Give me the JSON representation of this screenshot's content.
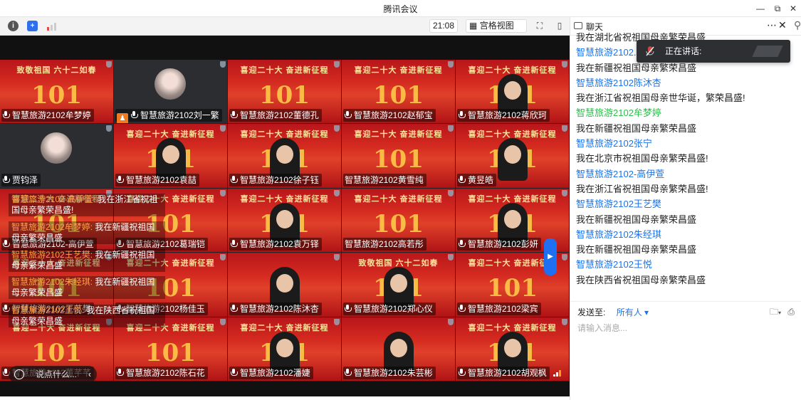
{
  "window": {
    "title": "腾讯会议"
  },
  "toolbar": {
    "time": "21:08",
    "view_label": "宫格视图",
    "colors": {
      "info": "#555555",
      "shield": "#2f6fec",
      "signal": "#e24b4b"
    }
  },
  "tiles": [
    {
      "name": "智慧旅游2102牟梦婷",
      "banner": "致敬祖国 六十二如春",
      "big": "101",
      "style": "red",
      "mic": "on"
    },
    {
      "name": "智慧旅游2102刘一繁",
      "banner": "",
      "big": "",
      "style": "dark-avatar",
      "mic": "speaking"
    },
    {
      "name": "智慧旅游2102董德孔",
      "banner": "喜迎二十大 奋进新征程",
      "big": "101",
      "style": "red",
      "mic": "off"
    },
    {
      "name": "智慧旅游2102赵郁宝",
      "banner": "喜迎二十大 奋进新征程",
      "big": "101",
      "style": "red",
      "mic": "off"
    },
    {
      "name": "智慧旅游2102蒋欣珂",
      "banner": "喜迎二十大 奋进新征程",
      "big": "101",
      "style": "red-person",
      "mic": "off"
    },
    {
      "name": "贾钧泽",
      "banner": "",
      "big": "",
      "style": "dark-avatar",
      "mic": "off"
    },
    {
      "name": "智慧旅游2102袁喆",
      "banner": "喜迎二十大 奋进新征程",
      "big": "101",
      "style": "red-person",
      "mic": "off"
    },
    {
      "name": "智慧旅游2102徐子钰",
      "banner": "喜迎二十大 奋进新征程",
      "big": "101",
      "style": "red-person",
      "mic": "off"
    },
    {
      "name": "智慧旅游2102黄雪纯",
      "banner": "喜迎二十大 奋进新征程",
      "big": "101",
      "style": "red",
      "mic": "none"
    },
    {
      "name": "黄昱皓",
      "banner": "喜迎二十大 奋进新征程",
      "big": "101",
      "style": "red-person",
      "mic": "off"
    },
    {
      "name": "智慧旅游2102-高伊萱",
      "banner": "喜迎二十大 奋进新征程",
      "big": "101",
      "style": "red",
      "mic": "off"
    },
    {
      "name": "智慧旅游2102葛瑞铠",
      "banner": "喜迎二十大 奋进新征程",
      "big": "101",
      "style": "red",
      "mic": "off"
    },
    {
      "name": "智慧旅游2102袁万铎",
      "banner": "喜迎二十大 奋进新征程",
      "big": "101",
      "style": "red-person",
      "mic": "off"
    },
    {
      "name": "智慧旅游2102高若彤",
      "banner": "喜迎二十大 奋进新征程",
      "big": "101",
      "style": "red",
      "mic": "none"
    },
    {
      "name": "智慧旅游2102彭妍",
      "banner": "喜迎二十大 奋进新征程",
      "big": "101",
      "style": "red-person",
      "mic": "off"
    },
    {
      "name": "智慧旅游2102王艺樊",
      "banner": "喜迎二十大 奋进新征程",
      "big": "101",
      "style": "red",
      "mic": "off"
    },
    {
      "name": "智慧旅游2102杨佳玉",
      "banner": "喜迎二十大 奋进新征程",
      "big": "101",
      "style": "red",
      "mic": "off"
    },
    {
      "name": "智慧旅游2102陈沐杏",
      "banner": "",
      "big": "",
      "style": "red-person",
      "mic": "off"
    },
    {
      "name": "智慧旅游2102郑心仪",
      "banner": "致敬祖国 六十二如春",
      "big": "101",
      "style": "red-person",
      "mic": "off"
    },
    {
      "name": "智慧旅游2102梁宾",
      "banner": "喜迎二十大 奋进新征程",
      "big": "101",
      "style": "red",
      "mic": "off"
    },
    {
      "name": "智慧旅游2102董芊芊",
      "banner": "喜迎二十大 奋进新征程",
      "big": "101",
      "style": "red",
      "mic": "off"
    },
    {
      "name": "智慧旅游2102陈石花",
      "banner": "喜迎二十大 奋进新征程",
      "big": "101",
      "style": "red",
      "mic": "off"
    },
    {
      "name": "智慧旅游2102潘婕",
      "banner": "喜迎二十大 奋进新征程",
      "big": "101",
      "style": "red-person",
      "mic": "off"
    },
    {
      "name": "智慧旅游2102朱芸彬",
      "banner": "",
      "big": "",
      "style": "red-person",
      "mic": "off"
    },
    {
      "name": "智慧旅游2102胡观枫",
      "banner": "喜迎二十大 奋进新征程",
      "big": "101",
      "style": "red-person",
      "mic": "off"
    }
  ],
  "bullet_comments": [
    {
      "sender": "智慧旅游2102-高伊萱:",
      "text": "我在浙江省祝祖国母亲繁荣昌盛!"
    },
    {
      "sender": "智慧旅游2102牟梦婷:",
      "text": "我在新疆祝祖国母亲繁荣昌盛"
    },
    {
      "sender": "智慧旅游2102王艺樊:",
      "text": "我在新疆祝祖国母亲繁荣昌盛"
    },
    {
      "sender": "智慧旅游2102朱经琪:",
      "text": "我在新疆祝祖国母亲繁荣昌盛"
    },
    {
      "sender": "智慧旅游2102王悦:",
      "text": "我在陕西省祝祖国母亲繁荣昌盛"
    }
  ],
  "say_placeholder": "说点什么...",
  "chat": {
    "title": "聊天",
    "speaking_label": "正在讲话:",
    "messages": [
      {
        "type": "text",
        "text": "我在湖北省祝祖国母亲繁荣昌盛"
      },
      {
        "type": "sender",
        "text": "智慧旅游2102..."
      },
      {
        "type": "text",
        "text": "我在新疆祝祖国母亲繁荣昌盛"
      },
      {
        "type": "sender",
        "text": "智慧旅游2102陈沐杏"
      },
      {
        "type": "text",
        "text": "我在浙江省祝祖国母亲世华诞，繁荣昌盛!"
      },
      {
        "type": "sender-green",
        "text": "智慧旅游2102牟梦婷"
      },
      {
        "type": "text",
        "text": "我在新疆祝祖国母亲繁荣昌盛"
      },
      {
        "type": "sender",
        "text": "智慧旅游2102张宁"
      },
      {
        "type": "text",
        "text": "我在北京市祝祖国母亲繁荣昌盛!"
      },
      {
        "type": "sender",
        "text": "智慧旅游2102-高伊萱"
      },
      {
        "type": "text",
        "text": "我在浙江省祝祖国母亲繁荣昌盛!"
      },
      {
        "type": "sender",
        "text": "智慧旅游2102王艺樊"
      },
      {
        "type": "text",
        "text": "我在新疆祝祖国母亲繁荣昌盛"
      },
      {
        "type": "sender",
        "text": "智慧旅游2102朱经琪"
      },
      {
        "type": "text",
        "text": "我在新疆祝祖国母亲繁荣昌盛"
      },
      {
        "type": "sender",
        "text": "智慧旅游2102王悦"
      },
      {
        "type": "text",
        "text": "我在陕西省祝祖国母亲繁荣昌盛"
      }
    ],
    "send_to_label": "发送至:",
    "send_to_value": "所有人",
    "input_placeholder": "请输入消息..."
  }
}
